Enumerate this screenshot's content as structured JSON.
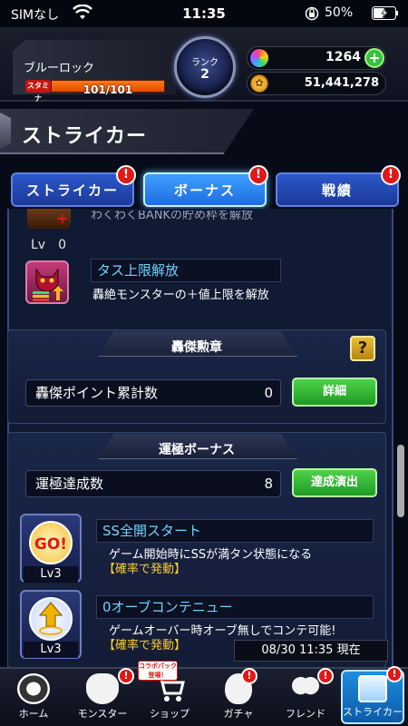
{
  "status_bar": {
    "carrier": "SIMなし",
    "time": "11:35",
    "battery": "50%"
  },
  "header": {
    "player_name": "ブルーロック",
    "stamina_label": "スタミナ",
    "stamina": "101/101",
    "stamina_fraction": 1.0,
    "rank_label": "ランク",
    "rank_value": "2",
    "gems": "1264",
    "coins": "51,441,278"
  },
  "page_title": "ストライカー",
  "tabs": [
    {
      "label": "ストライカー",
      "badge": "!"
    },
    {
      "label": "ボーナス",
      "badge": "!"
    },
    {
      "label": "戦績",
      "badge": "!"
    }
  ],
  "content": {
    "partial_item": {
      "desc": "わくわくBANKの貯め枠を解放",
      "lv": "Lv　0"
    },
    "tas_item": {
      "name": "タス上限解放",
      "desc": "轟絶モンスターの＋値上限を解放"
    },
    "gouketsu": {
      "header": "轟傑勲章",
      "help": "?",
      "stat_label": "轟傑ポイント累計数",
      "stat_value": "0",
      "button": "詳細"
    },
    "unkyoku": {
      "header": "運極ボーナス",
      "stat_label": "運極達成数",
      "stat_value": "8",
      "button": "達成演出",
      "bonuses": [
        {
          "name": "SS全開スタート",
          "desc": "ゲーム開始時にSSが満タン状態になる",
          "note": "【確率で発動】",
          "lv": "Lv3",
          "icon_text": "GO!"
        },
        {
          "name": "0オーブコンテニュー",
          "desc": "ゲームオーバー時オーブ無しでコンテ可能!",
          "note": "【確率で発動】",
          "lv": "Lv3",
          "icon_text": ""
        }
      ]
    },
    "timestamp": "08/30 11:35 現在"
  },
  "bottom_nav": {
    "items": [
      {
        "label": "ホーム"
      },
      {
        "label": "モンスター"
      },
      {
        "label": "ショップ"
      },
      {
        "label": "ガチャ"
      },
      {
        "label": "フレンド"
      },
      {
        "label": "ストライカー"
      }
    ],
    "collab_tag_line1": "コラボパック",
    "collab_tag_line2": "登場！"
  }
}
